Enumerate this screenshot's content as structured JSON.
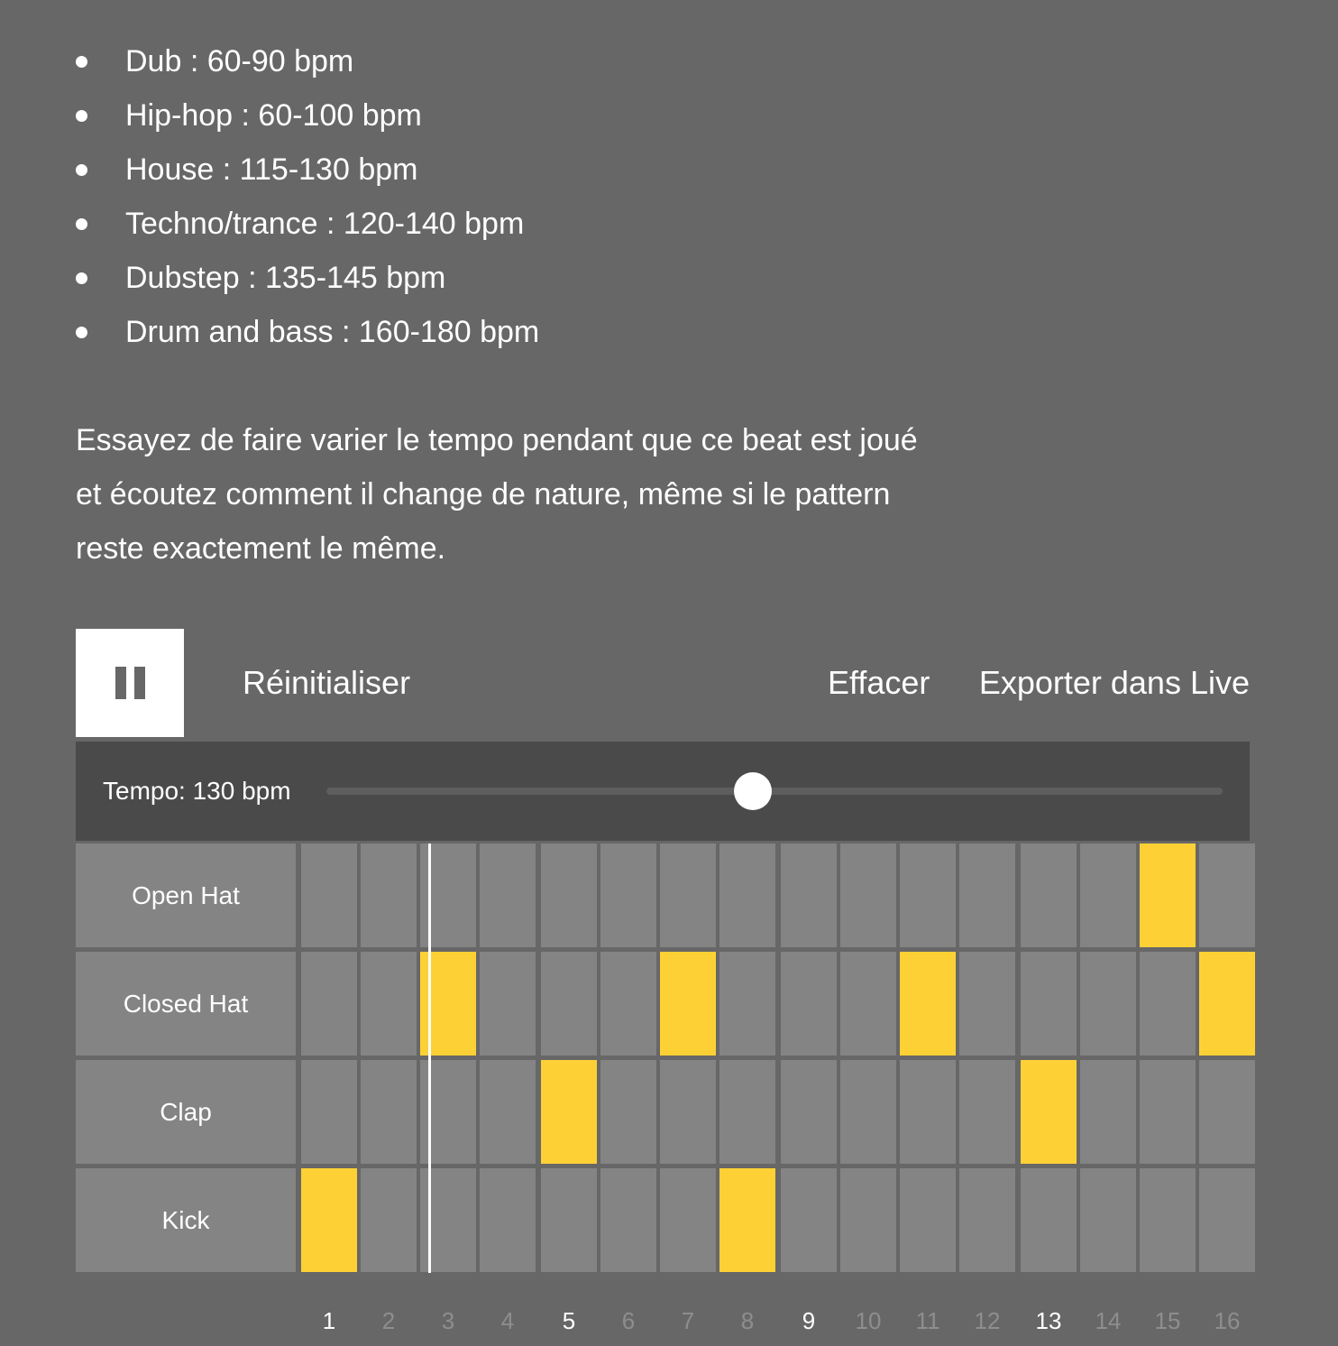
{
  "tempo_guide": [
    {
      "text": "Dub : 60-90 bpm"
    },
    {
      "text": "Hip-hop : 60-100 bpm"
    },
    {
      "text": "House :  115-130 bpm"
    },
    {
      "text": "Techno/trance :  120-140 bpm"
    },
    {
      "text": "Dubstep :  135-145 bpm"
    },
    {
      "text": "Drum and bass :  160-180 bpm"
    }
  ],
  "intro": {
    "line1": "Essayez de faire varier le tempo pendant que ce beat est joué",
    "line2": "et écoutez comment il change de nature, même si le pattern",
    "line3": "reste exactement le même."
  },
  "toolbar": {
    "play_state": "playing",
    "reset_label": "Réinitialiser",
    "clear_label": "Effacer",
    "export_label": "Exporter dans Live"
  },
  "tempo": {
    "label": "Tempo: 130 bpm",
    "slider_fraction": 0.476
  },
  "sequencer": {
    "current_step": 3,
    "rows": [
      {
        "label": "Open Hat",
        "steps": [
          0,
          0,
          0,
          0,
          0,
          0,
          0,
          0,
          0,
          0,
          0,
          0,
          0,
          0,
          1,
          0
        ]
      },
      {
        "label": "Closed Hat",
        "steps": [
          0,
          0,
          1,
          0,
          0,
          0,
          1,
          0,
          0,
          0,
          1,
          0,
          0,
          0,
          0,
          1
        ]
      },
      {
        "label": "Clap",
        "steps": [
          0,
          0,
          0,
          0,
          1,
          0,
          0,
          0,
          0,
          0,
          0,
          0,
          1,
          0,
          0,
          0
        ]
      },
      {
        "label": "Kick",
        "steps": [
          1,
          0,
          0,
          0,
          0,
          0,
          0,
          1,
          0,
          0,
          0,
          0,
          0,
          0,
          0,
          0
        ]
      }
    ],
    "step_numbers": [
      "1",
      "2",
      "3",
      "4",
      "5",
      "6",
      "7",
      "8",
      "9",
      "10",
      "11",
      "12",
      "13",
      "14",
      "15",
      "16"
    ]
  },
  "colors": {
    "background": "#676767",
    "cell_off": "#848484",
    "cell_on": "#fdd135",
    "panel": "#4a4a4a"
  }
}
